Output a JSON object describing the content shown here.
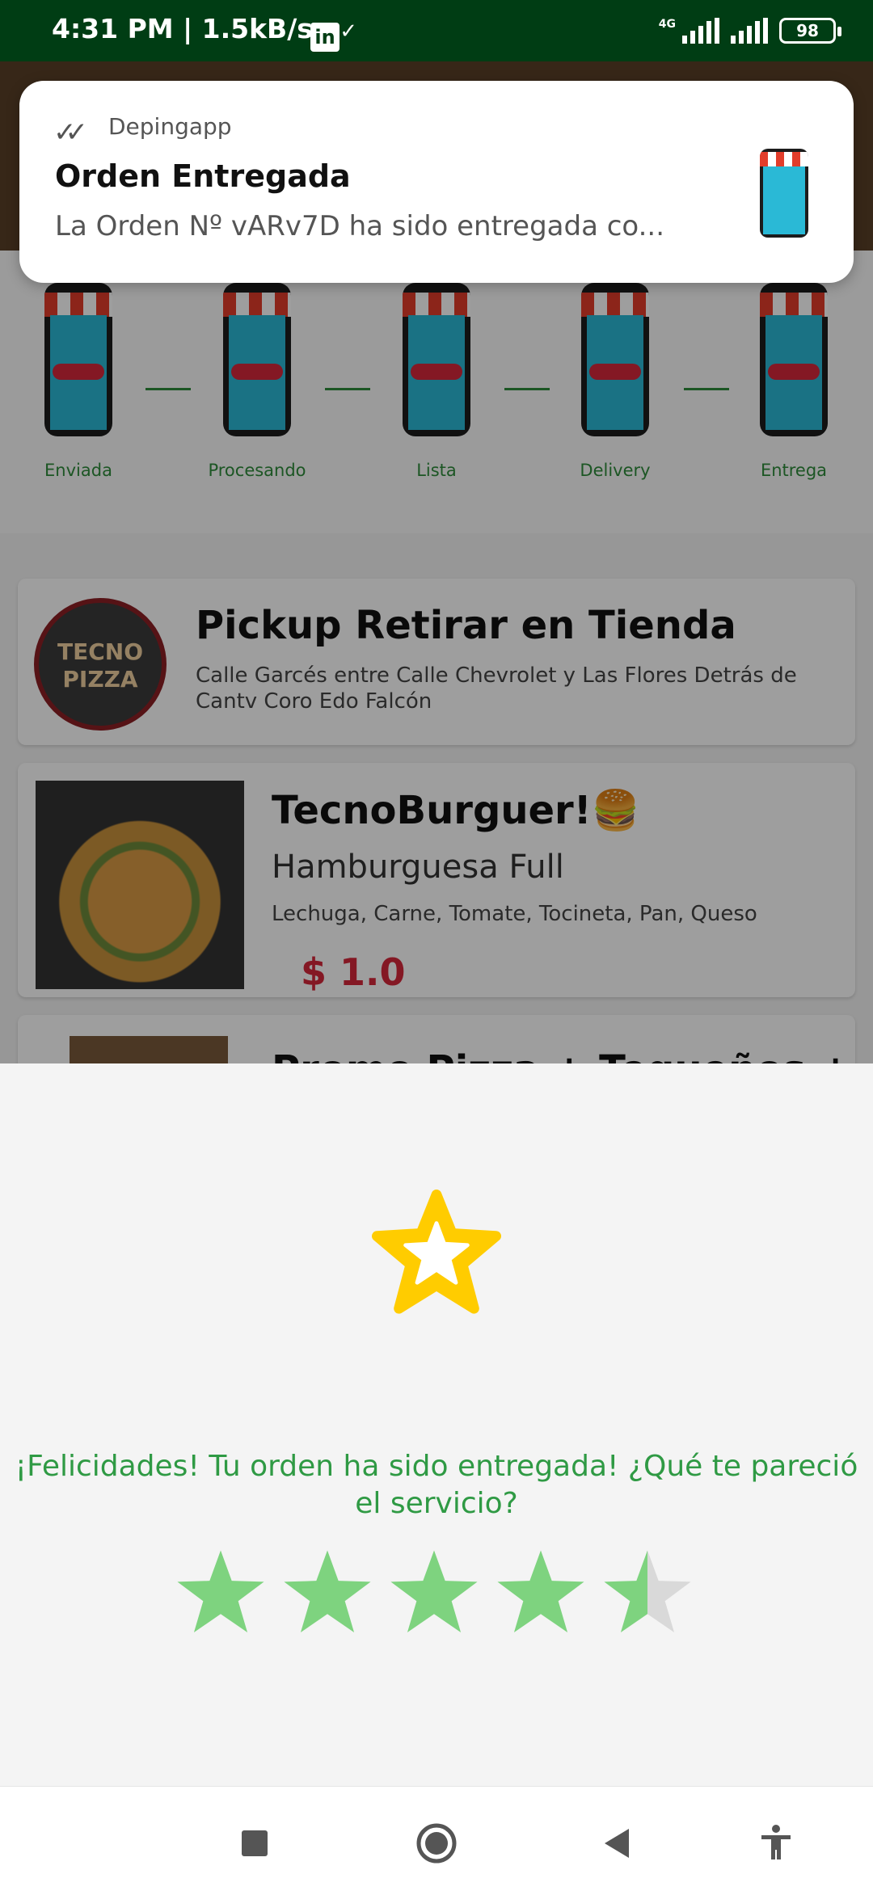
{
  "status_bar": {
    "time": "4:31 PM",
    "speed": "1.5kB/s",
    "checks": "✓✓",
    "linkedin": "in",
    "network": "4G",
    "battery": "98"
  },
  "notification": {
    "app_name": "Depingapp",
    "title": "Orden Entregada",
    "body": "La Orden Nº vARv7D ha sido entregada co..."
  },
  "background": {
    "steps": [
      {
        "label": "Enviada"
      },
      {
        "label": "Procesando"
      },
      {
        "label": "Lista"
      },
      {
        "label": "Delivery"
      },
      {
        "label": "Entrega"
      }
    ],
    "store": {
      "logo_text": "TECNO PIZZA",
      "title": "Pickup Retirar en Tienda",
      "address": "Calle Garcés entre Calle Chevrolet y Las Flores Detrás de Cantv Coro Edo Falcón"
    },
    "product": {
      "title": "TecnoBurguer!🍔",
      "subtitle": "Hamburguesa Full",
      "ingredients": "Lechuga, Carne, Tomate, Tocineta, Pan, Queso",
      "price": "$ 1.0"
    },
    "next_product_title": "Promo Pizza + Tequeños +"
  },
  "rating_sheet": {
    "prompt": "¡Felicidades! Tu orden ha sido entregada! ¿Qué te pareció el servicio?",
    "rating": 4.5,
    "max_rating": 5,
    "star_color": "#7ed37f",
    "empty_color": "#d9d9d9",
    "badge_color": "#ffcc00"
  },
  "nav_bar": {
    "icons": [
      "recents-square-icon",
      "home-circle-icon",
      "back-triangle-icon",
      "accessibility-icon"
    ]
  }
}
